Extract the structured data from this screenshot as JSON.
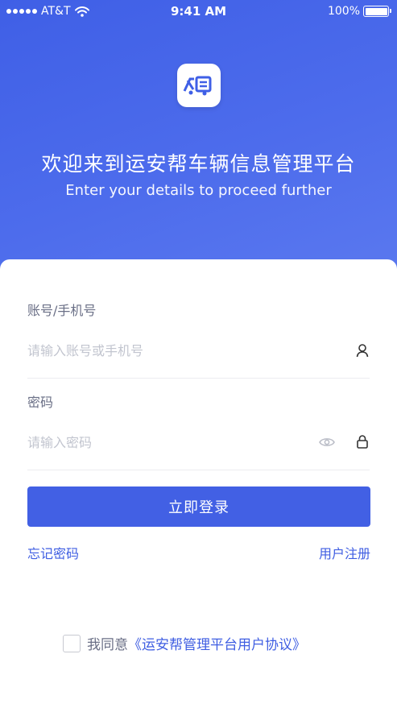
{
  "status_bar": {
    "carrier": "AT&T",
    "time": "9:41 AM",
    "battery": "100%"
  },
  "header": {
    "title": "欢迎来到运安帮车辆信息管理平台",
    "subtitle": "Enter your details to proceed further"
  },
  "form": {
    "account_label": "账号/手机号",
    "account_placeholder": "请输入账号或手机号",
    "password_label": "密码",
    "password_placeholder": "请输入密码",
    "login_button": "立即登录",
    "forgot_link": "忘记密码",
    "register_link": "用户注册"
  },
  "agreement": {
    "prefix": "我同意",
    "link": "《运安帮管理平台用户协议》"
  },
  "colors": {
    "primary": "#4260e4",
    "hero_gradient_start": "#3f5fe6",
    "link": "#3f5ee2"
  },
  "icons": {
    "logo": "truck-logo-icon",
    "account": "user-icon",
    "password_visibility": "eye-icon",
    "password": "lock-icon"
  }
}
